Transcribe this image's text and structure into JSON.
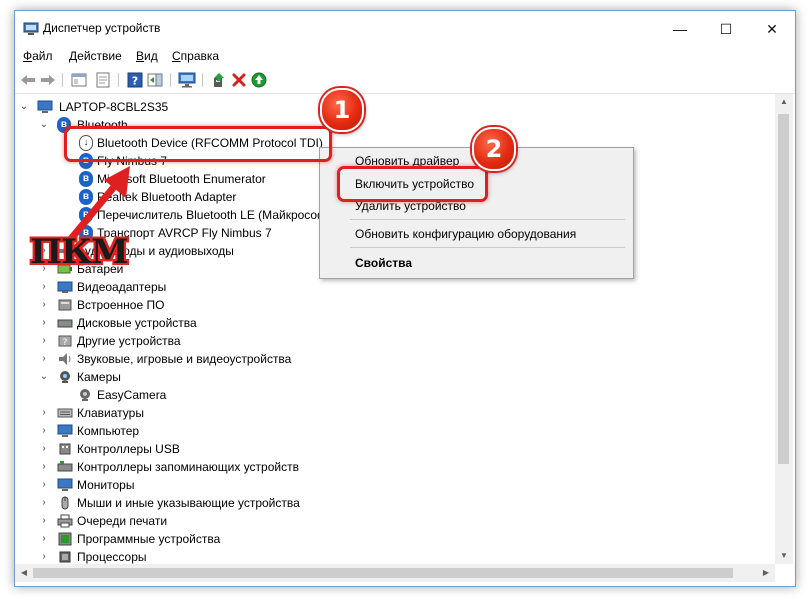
{
  "window": {
    "title": "Диспетчер устройств",
    "controls": {
      "minimize": "—",
      "maximize": "☐",
      "close": "✕"
    }
  },
  "menu": {
    "file": {
      "accel": "Ф",
      "rest": "айл"
    },
    "action": {
      "accel": "Д",
      "rest": "ействие"
    },
    "view": {
      "accel": "В",
      "rest": "ид"
    },
    "help": {
      "accel": "С",
      "rest": "правка"
    }
  },
  "toolbar": {
    "back": "←",
    "forward": "→",
    "help": "?"
  },
  "tree": {
    "root": "LAPTOP-8CBL2S35",
    "bluetooth": {
      "label": "Bluetooth",
      "children": [
        "Bluetooth Device (RFCOMM Protocol TDI)",
        "Fly Nimbus 7",
        "Microsoft Bluetooth Enumerator",
        "Realtek Bluetooth Adapter",
        "Перечислитель Bluetooth LE (Майкрософт)",
        "Транспорт AVRCP Fly Nimbus 7"
      ]
    },
    "categories_a": [
      "Аудиовходы и аудиовыходы",
      "Батареи",
      "Видеоадаптеры",
      "Встроенное ПО",
      "Дисковые устройства",
      "Другие устройства",
      "Звуковые, игровые и видеоустройства"
    ],
    "cameras": {
      "label": "Камеры",
      "child": "EasyCamera"
    },
    "categories_b": [
      "Клавиатуры",
      "Компьютер",
      "Контроллеры USB",
      "Контроллеры запоминающих устройств",
      "Мониторы",
      "Мыши и иные указывающие устройства",
      "Очереди печати",
      "Программные устройства",
      "Процессоры"
    ]
  },
  "context_menu": {
    "update_driver": "Обновить драйвер",
    "enable_device": "Включить устройство",
    "delete_device": "Удалить устройство",
    "scan_hardware": "Обновить конфигурацию оборудования",
    "properties": "Свойства"
  },
  "annotations": {
    "badge1": "1",
    "badge2": "2",
    "rmb": "ПКМ",
    "color": "#e02020"
  },
  "icons": [
    "app-icon",
    "back-icon",
    "forward-icon",
    "console-tree-icon",
    "properties-icon",
    "help-icon",
    "action-pane-icon",
    "monitor-icon",
    "add-driver-icon",
    "uninstall-icon",
    "enable-icon",
    "bluetooth-icon",
    "camera-icon"
  ]
}
